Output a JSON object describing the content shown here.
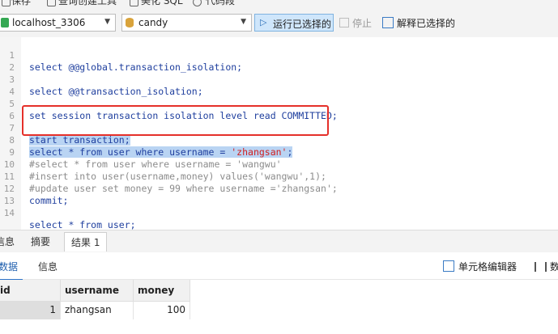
{
  "top_menu": {
    "save": "保存",
    "query_builder": "查询创建工具",
    "beautify": "美化 SQL",
    "code_snippet": "代码段"
  },
  "toolbar": {
    "connection": "localhost_3306",
    "database": "candy",
    "run_selected": "运行已选择的",
    "stop": "停止",
    "explain_selected": "解释已选择的"
  },
  "editor": {
    "lines": [
      {
        "n": "1",
        "text": "select @@global.transaction_isolation;"
      },
      {
        "n": "2",
        "text": ""
      },
      {
        "n": "3",
        "text": "select @@transaction_isolation;"
      },
      {
        "n": "4",
        "text": ""
      },
      {
        "n": "5",
        "text": "set session transaction isolation level read COMMITTED;"
      },
      {
        "n": "6",
        "text": ""
      },
      {
        "n": "7",
        "text": "start transaction;"
      },
      {
        "n": "8",
        "pre": "select * from user where username = ",
        "str": "'zhangsan'",
        "post": ";"
      },
      {
        "n": "9",
        "text": "#select * from user where username = 'wangwu'"
      },
      {
        "n": "10",
        "text": "#insert into user(username,money) values('wangwu',1);"
      },
      {
        "n": "11",
        "text": "#update user set money = 99 where username ='zhangsan';"
      },
      {
        "n": "12",
        "text": "commit;"
      },
      {
        "n": "13",
        "text": ""
      },
      {
        "n": "14",
        "text": "select * from user;"
      }
    ]
  },
  "bottom_tabs": {
    "info": "信息",
    "summary": "摘要",
    "result1": "结果 1"
  },
  "sub_tabs": {
    "data": "数据",
    "info": "信息",
    "cell_editor": "单元格编辑器",
    "more": "数据"
  },
  "grid": {
    "headers": [
      "id",
      "username",
      "money"
    ],
    "rows": [
      [
        "1",
        "zhangsan",
        "100"
      ]
    ]
  },
  "colors": {
    "selection": "#b9d4f3",
    "highlight_box": "#e5302a",
    "keyword": "#1f3f9e",
    "string": "#d11f1f",
    "comment": "#8c8c8c"
  }
}
